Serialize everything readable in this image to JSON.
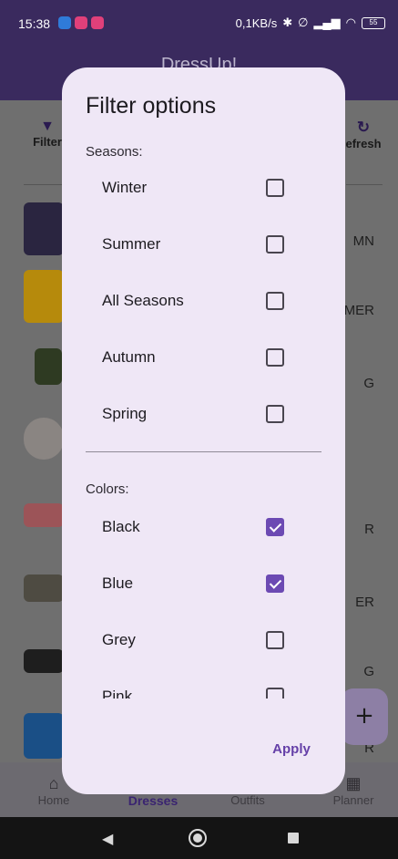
{
  "status_bar": {
    "time": "15:38",
    "network_speed": "0,1KB/s",
    "battery": "55"
  },
  "app_bar": {
    "title": "DressUp!"
  },
  "toolbar": {
    "filter_label": "Filter",
    "refresh_label": "efresh"
  },
  "background_list": {
    "labels": [
      "MN",
      "MER",
      "G",
      "R",
      "ER",
      "G",
      "R"
    ]
  },
  "fab": {
    "label": "+"
  },
  "bottom_nav": {
    "items": [
      {
        "label": "Home"
      },
      {
        "label": "Dresses"
      },
      {
        "label": "Outfits"
      },
      {
        "label": "Planner"
      }
    ]
  },
  "dialog": {
    "title": "Filter options",
    "seasons": {
      "label": "Seasons:",
      "options": [
        {
          "label": "Winter",
          "checked": false
        },
        {
          "label": "Summer",
          "checked": false
        },
        {
          "label": "All Seasons",
          "checked": false
        },
        {
          "label": "Autumn",
          "checked": false
        },
        {
          "label": "Spring",
          "checked": false
        }
      ]
    },
    "colors": {
      "label": "Colors:",
      "options": [
        {
          "label": "Black",
          "checked": true
        },
        {
          "label": "Blue",
          "checked": true
        },
        {
          "label": "Grey",
          "checked": false
        },
        {
          "label": "Pink",
          "checked": false
        }
      ]
    },
    "apply_label": "Apply"
  },
  "theme": {
    "accent": "#6c4ab3",
    "dialog_background": "#efe7f6",
    "app_bar": "#3a2a5e"
  }
}
